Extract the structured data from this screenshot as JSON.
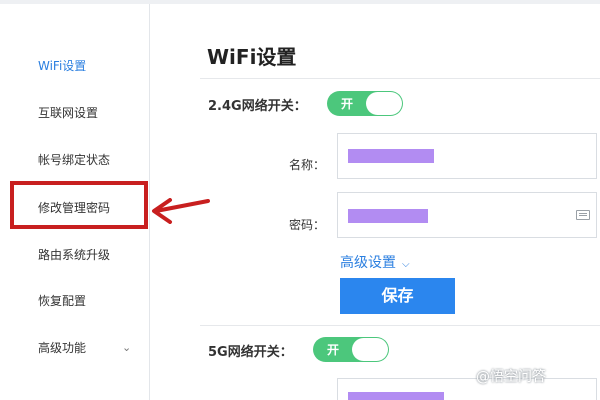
{
  "sidebar": {
    "items": [
      {
        "label": "WiFi设置"
      },
      {
        "label": "互联网设置"
      },
      {
        "label": "帐号绑定状态"
      },
      {
        "label": "修改管理密码"
      },
      {
        "label": "路由系统升级"
      },
      {
        "label": "恢复配置"
      },
      {
        "label": "高级功能"
      }
    ],
    "active_index": 0,
    "highlighted_index": 3
  },
  "main": {
    "title": "WiFi设置",
    "band_24g": {
      "label": "2.4G网络开关：",
      "toggle_text": "开",
      "enabled": true,
      "name_label": "名称：",
      "password_label": "密码："
    },
    "advanced_link": "高级设置",
    "save_label": "保存",
    "band_5g": {
      "label": "5G网络开关：",
      "toggle_text": "开",
      "enabled": true
    }
  },
  "watermark": "@悟空问答",
  "colors": {
    "accent": "#2b7fe0",
    "toggle_on": "#4cc77c",
    "highlight": "#c81f1f",
    "redaction": "#b28cf2"
  }
}
